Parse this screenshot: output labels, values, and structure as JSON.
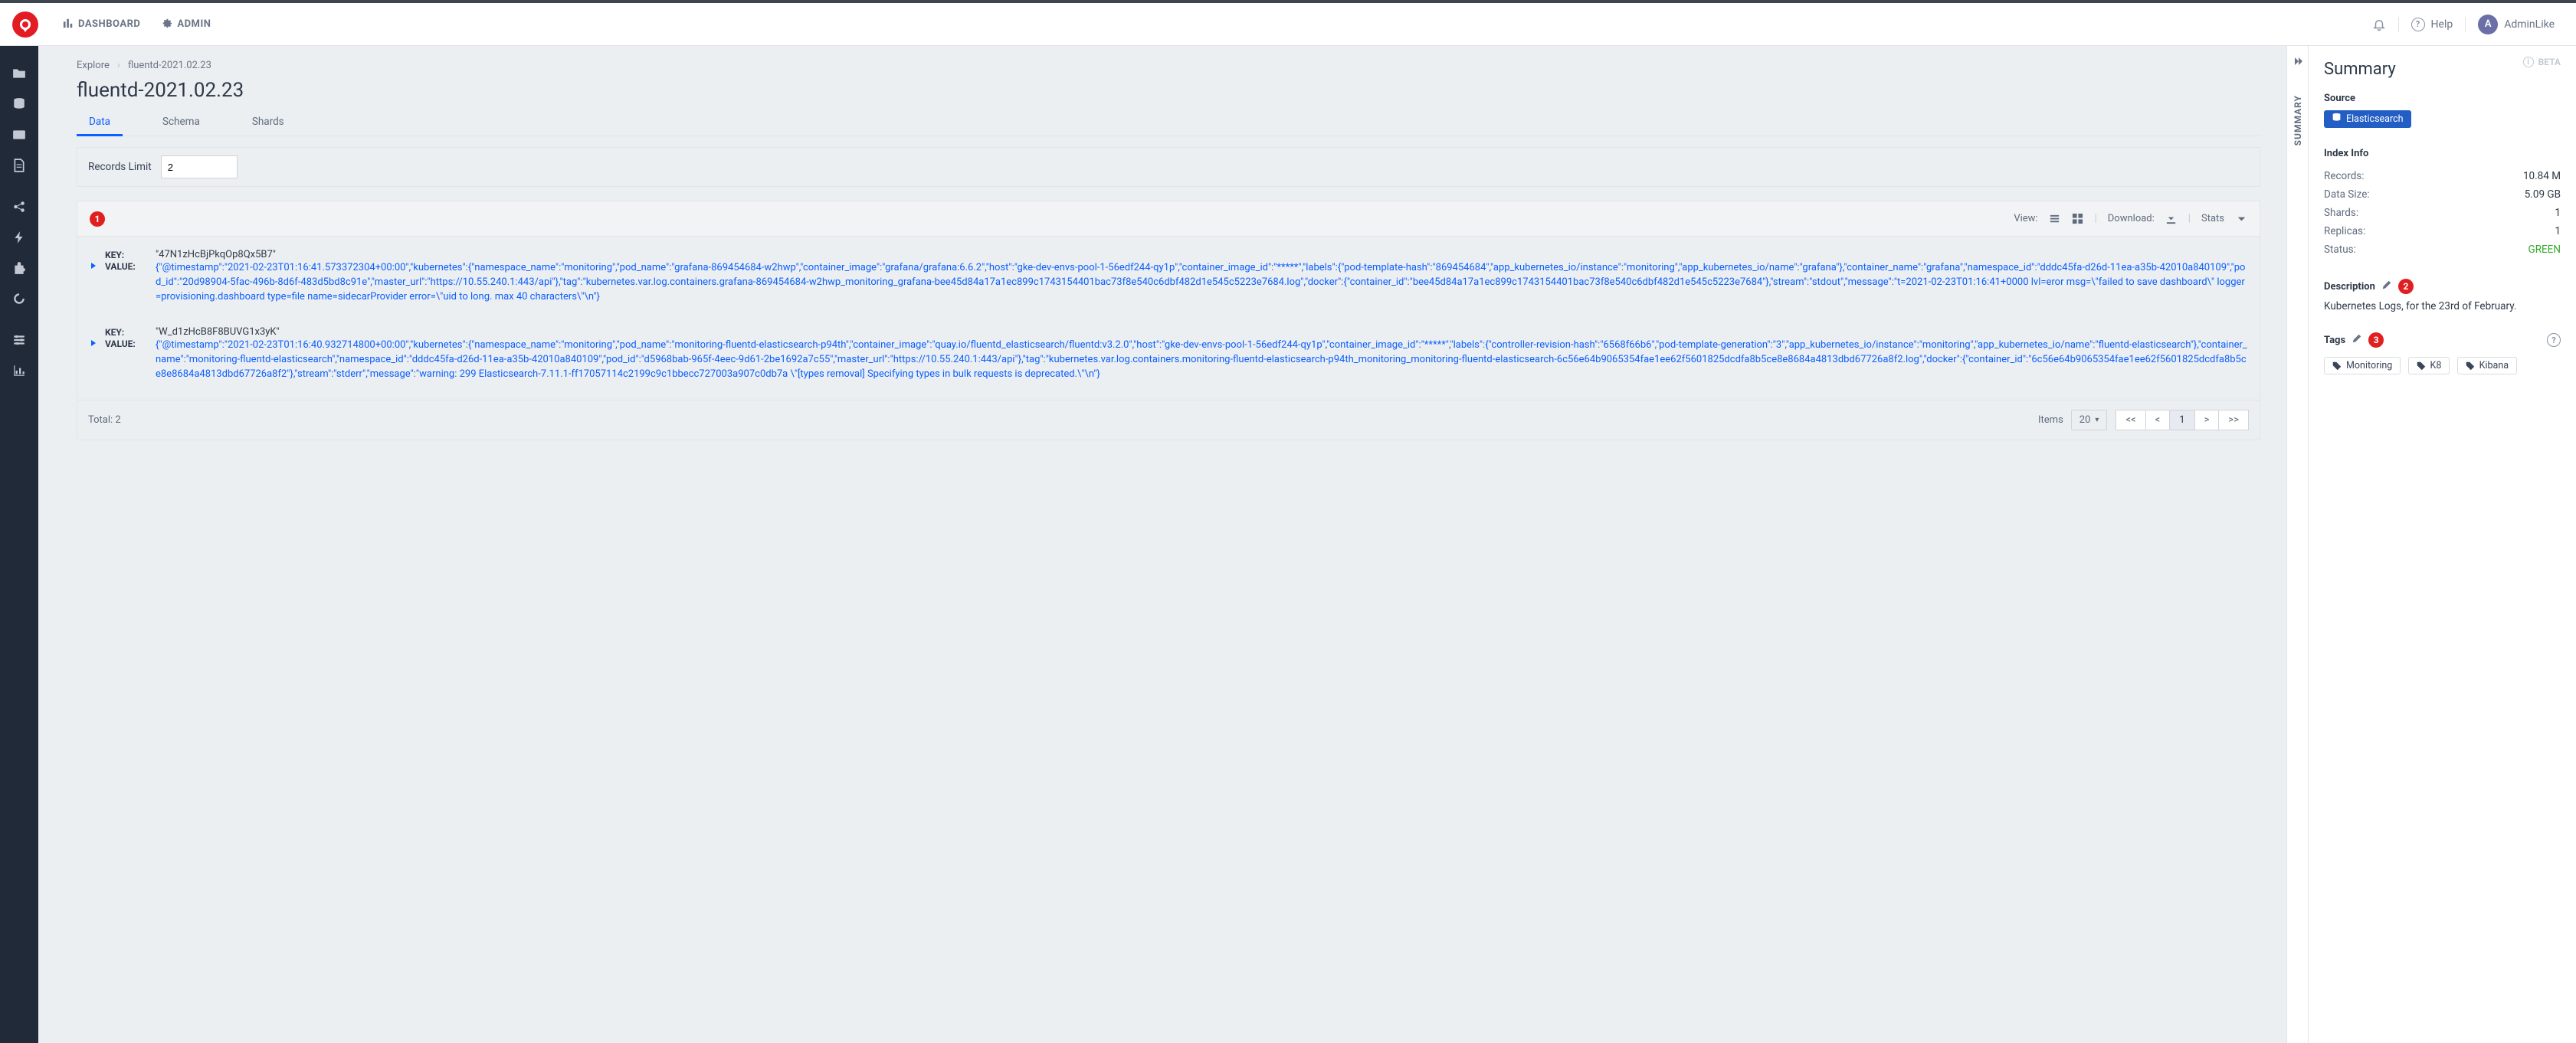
{
  "top_nav": {
    "dashboard": "DASHBOARD",
    "admin": "ADMIN",
    "help_label": "Help",
    "user_name": "AdminLike",
    "user_initial": "A"
  },
  "breadcrumb": {
    "root": "Explore",
    "current": "fluentd-2021.02.23"
  },
  "page_title": "fluentd-2021.02.23",
  "tabs": {
    "data": "Data",
    "schema": "Schema",
    "shards": "Shards"
  },
  "records_limit": {
    "label": "Records Limit",
    "value": "2"
  },
  "view_bar": {
    "badge": "1",
    "view_label": "View:",
    "download_label": "Download:",
    "stats_label": "Stats"
  },
  "records": {
    "key_label": "KEY:",
    "value_label": "VALUE:",
    "items": [
      {
        "key": "\"47N1zHcBjPkqOp8Qx5B7\"",
        "value": "{\"@timestamp\":\"2021-02-23T01:16:41.573372304+00:00\",\"kubernetes\":{\"namespace_name\":\"monitoring\",\"pod_name\":\"grafana-869454684-w2hwp\",\"container_image\":\"grafana/grafana:6.6.2\",\"host\":\"gke-dev-envs-pool-1-56edf244-qy1p\",\"container_image_id\":\"*****\",\"labels\":{\"pod-template-hash\":\"869454684\",\"app_kubernetes_io/instance\":\"monitoring\",\"app_kubernetes_io/name\":\"grafana\"},\"container_name\":\"grafana\",\"namespace_id\":\"dddc45fa-d26d-11ea-a35b-42010a840109\",\"pod_id\":\"20d98904-5fac-496b-8d6f-483d5bd8c91e\",\"master_url\":\"https://10.55.240.1:443/api\"},\"tag\":\"kubernetes.var.log.containers.grafana-869454684-w2hwp_monitoring_grafana-bee45d84a17a1ec899c1743154401bac73f8e540c6dbf482d1e545c5223e7684.log\",\"docker\":{\"container_id\":\"bee45d84a17a1ec899c1743154401bac73f8e540c6dbf482d1e545c5223e7684\"},\"stream\":\"stdout\",\"message\":\"t=2021-02-23T01:16:41+0000 lvl=eror msg=\\\"failed to save dashboard\\\" logger=provisioning.dashboard type=file name=sidecarProvider error=\\\"uid to long. max 40 characters\\\"\\n\"}"
      },
      {
        "key": "\"W_d1zHcB8F8BUVG1x3yK\"",
        "value": "{\"@timestamp\":\"2021-02-23T01:16:40.932714800+00:00\",\"kubernetes\":{\"namespace_name\":\"monitoring\",\"pod_name\":\"monitoring-fluentd-elasticsearch-p94th\",\"container_image\":\"quay.io/fluentd_elasticsearch/fluentd:v3.2.0\",\"host\":\"gke-dev-envs-pool-1-56edf244-qy1p\",\"container_image_id\":\"*****\",\"labels\":{\"controller-revision-hash\":\"6568f66b6\",\"pod-template-generation\":\"3\",\"app_kubernetes_io/instance\":\"monitoring\",\"app_kubernetes_io/name\":\"fluentd-elasticsearch\"},\"container_name\":\"monitoring-fluentd-elasticsearch\",\"namespace_id\":\"dddc45fa-d26d-11ea-a35b-42010a840109\",\"pod_id\":\"d5968bab-965f-4eec-9d61-2be1692a7c55\",\"master_url\":\"https://10.55.240.1:443/api\"},\"tag\":\"kubernetes.var.log.containers.monitoring-fluentd-elasticsearch-p94th_monitoring_monitoring-fluentd-elasticsearch-6c56e64b9065354fae1ee62f5601825dcdfa8b5ce8e8684a4813dbd67726a8f2.log\",\"docker\":{\"container_id\":\"6c56e64b9065354fae1ee62f5601825dcdfa8b5ce8e8684a4813dbd67726a8f2\"},\"stream\":\"stderr\",\"message\":\"warning: 299 Elasticsearch-7.11.1-ff17057114c2199c9c1bbecc727003a907c0db7a \\\"[types removal] Specifying types in bulk requests is deprecated.\\\"\\n\"}"
      }
    ]
  },
  "footer": {
    "total_label": "Total: 2",
    "items_label": "Items",
    "page_size": "20",
    "first": "<<",
    "prev": "<",
    "current": "1",
    "next": ">",
    "last": ">>"
  },
  "right": {
    "beta": "BETA",
    "summary_title": "Summary",
    "source_label": "Source",
    "source_value": "Elasticsearch",
    "index_info_label": "Index Info",
    "index_info": {
      "records_label": "Records:",
      "records_value": "10.84 M",
      "datasize_label": "Data Size:",
      "datasize_value": "5.09 GB",
      "shards_label": "Shards:",
      "shards_value": "1",
      "replicas_label": "Replicas:",
      "replicas_value": "1",
      "status_label": "Status:",
      "status_value": "GREEN"
    },
    "description_label": "Description",
    "description_badge": "2",
    "description_text": "Kubernetes Logs, for the 23rd of February.",
    "tags_label": "Tags",
    "tags_badge": "3",
    "tags": [
      "Monitoring",
      "K8",
      "Kibana"
    ]
  },
  "collapse_strip": {
    "label": "SUMMARY"
  }
}
